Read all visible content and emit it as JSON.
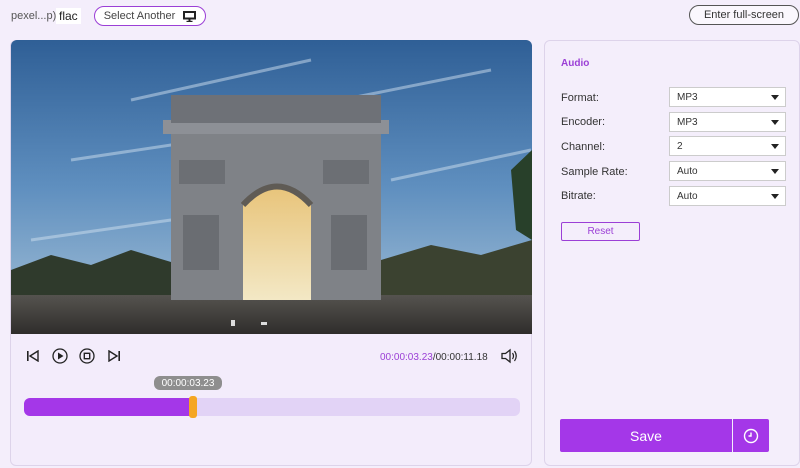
{
  "header": {
    "filename": "pexel...p).",
    "format_tag": "flac",
    "select_another_label": "Select Another",
    "fullscreen_label": "Enter full-screen"
  },
  "player": {
    "current_time": "00:00:03.23",
    "separator": "/",
    "total_time": "00:00:11.18",
    "tooltip_time": "00:00:03.23",
    "progress_fraction": 0.34
  },
  "audio": {
    "title": "Audio",
    "rows": [
      {
        "label": "Format:",
        "value": "MP3"
      },
      {
        "label": "Encoder:",
        "value": "MP3"
      },
      {
        "label": "Channel:",
        "value": "2"
      },
      {
        "label": "Sample Rate:",
        "value": "Auto"
      },
      {
        "label": "Bitrate:",
        "value": "Auto"
      }
    ],
    "reset_label": "Reset"
  },
  "actions": {
    "save_label": "Save"
  },
  "colors": {
    "accent": "#a437e8",
    "handle": "#f5a623",
    "background": "#f4eefb"
  },
  "icons": [
    "monitor-icon",
    "step-back-icon",
    "play-icon",
    "stop-icon",
    "step-forward-icon",
    "volume-icon",
    "clock-icon"
  ]
}
